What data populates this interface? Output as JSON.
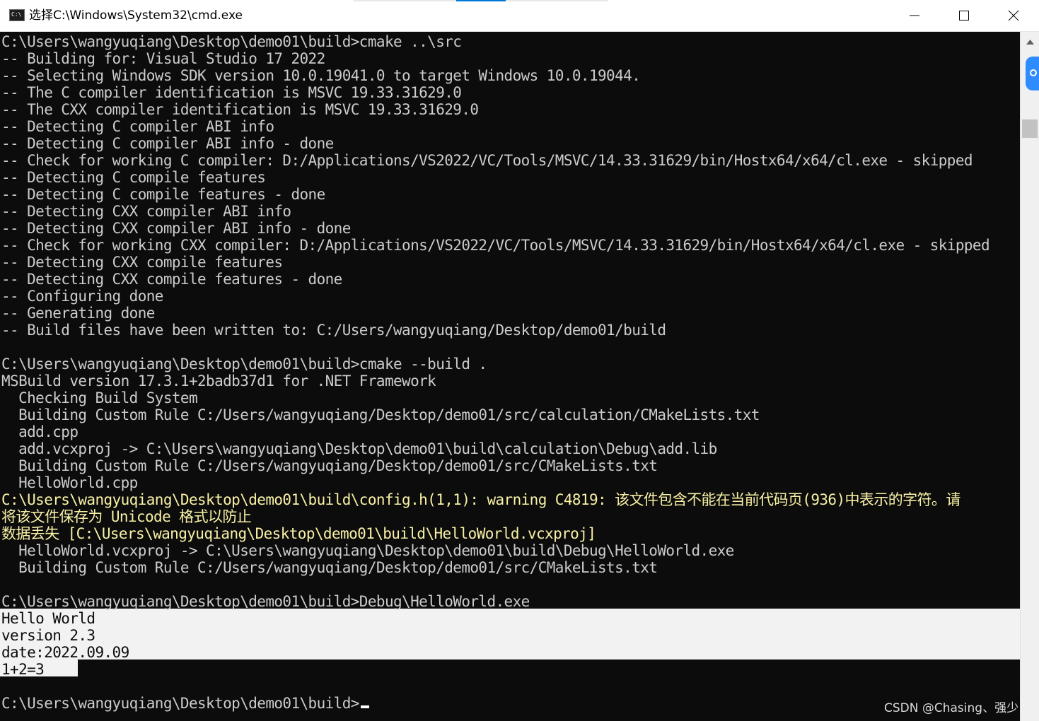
{
  "window": {
    "title": "选择C:\\Windows\\System32\\cmd.exe",
    "icon_text": "C:\\",
    "app_icon": "console-app-icon",
    "minimize_icon": "minimize-icon",
    "maximize_icon": "maximize-icon",
    "close_icon": "close-icon",
    "accent_color": "#0078d7"
  },
  "console": {
    "background": "#0c0c0c",
    "text_color": "#cccccc",
    "warning_color": "#f9f1a5",
    "selection_color": "#f2f2f2",
    "lines": [
      "C:\\Users\\wangyuqiang\\Desktop\\demo01\\build>cmake ..\\src",
      "-- Building for: Visual Studio 17 2022",
      "-- Selecting Windows SDK version 10.0.19041.0 to target Windows 10.0.19044.",
      "-- The C compiler identification is MSVC 19.33.31629.0",
      "-- The CXX compiler identification is MSVC 19.33.31629.0",
      "-- Detecting C compiler ABI info",
      "-- Detecting C compiler ABI info - done",
      "-- Check for working C compiler: D:/Applications/VS2022/VC/Tools/MSVC/14.33.31629/bin/Hostx64/x64/cl.exe - skipped",
      "-- Detecting C compile features",
      "-- Detecting C compile features - done",
      "-- Detecting CXX compiler ABI info",
      "-- Detecting CXX compiler ABI info - done",
      "-- Check for working CXX compiler: D:/Applications/VS2022/VC/Tools/MSVC/14.33.31629/bin/Hostx64/x64/cl.exe - skipped",
      "-- Detecting CXX compile features",
      "-- Detecting CXX compile features - done",
      "-- Configuring done",
      "-- Generating done",
      "-- Build files have been written to: C:/Users/wangyuqiang/Desktop/demo01/build",
      "",
      "C:\\Users\\wangyuqiang\\Desktop\\demo01\\build>cmake --build .",
      "MSBuild version 17.3.1+2badb37d1 for .NET Framework",
      "  Checking Build System",
      "  Building Custom Rule C:/Users/wangyuqiang/Desktop/demo01/src/calculation/CMakeLists.txt",
      "  add.cpp",
      "  add.vcxproj -> C:\\Users\\wangyuqiang\\Desktop\\demo01\\build\\calculation\\Debug\\add.lib",
      "  Building Custom Rule C:/Users/wangyuqiang/Desktop/demo01/src/CMakeLists.txt",
      "  HelloWorld.cpp"
    ],
    "warning_lines": [
      "C:\\Users\\wangyuqiang\\Desktop\\demo01\\build\\config.h(1,1): warning C4819: 该文件包含不能在当前代码页(936)中表示的字符。请",
      "将该文件保存为 Unicode 格式以防止",
      "数据丢失 [C:\\Users\\wangyuqiang\\Desktop\\demo01\\build\\HelloWorld.vcxproj]"
    ],
    "after_warning_lines": [
      "  HelloWorld.vcxproj -> C:\\Users\\wangyuqiang\\Desktop\\demo01\\build\\Debug\\HelloWorld.exe",
      "  Building Custom Rule C:/Users/wangyuqiang/Desktop/demo01/src/CMakeLists.txt",
      "",
      "C:\\Users\\wangyuqiang\\Desktop\\demo01\\build>Debug\\HelloWorld.exe"
    ],
    "selected_output_lines": [
      "Hello World",
      "version 2.3",
      "date:2022.09.09",
      "1+2=3"
    ],
    "trailing_lines": [
      ""
    ],
    "prompt": "C:\\Users\\wangyuqiang\\Desktop\\demo01\\build>"
  },
  "scrollbar": {
    "up_arrow_icon": "scroll-up-arrow-icon"
  },
  "watermark": "CSDN @Chasing、强少"
}
